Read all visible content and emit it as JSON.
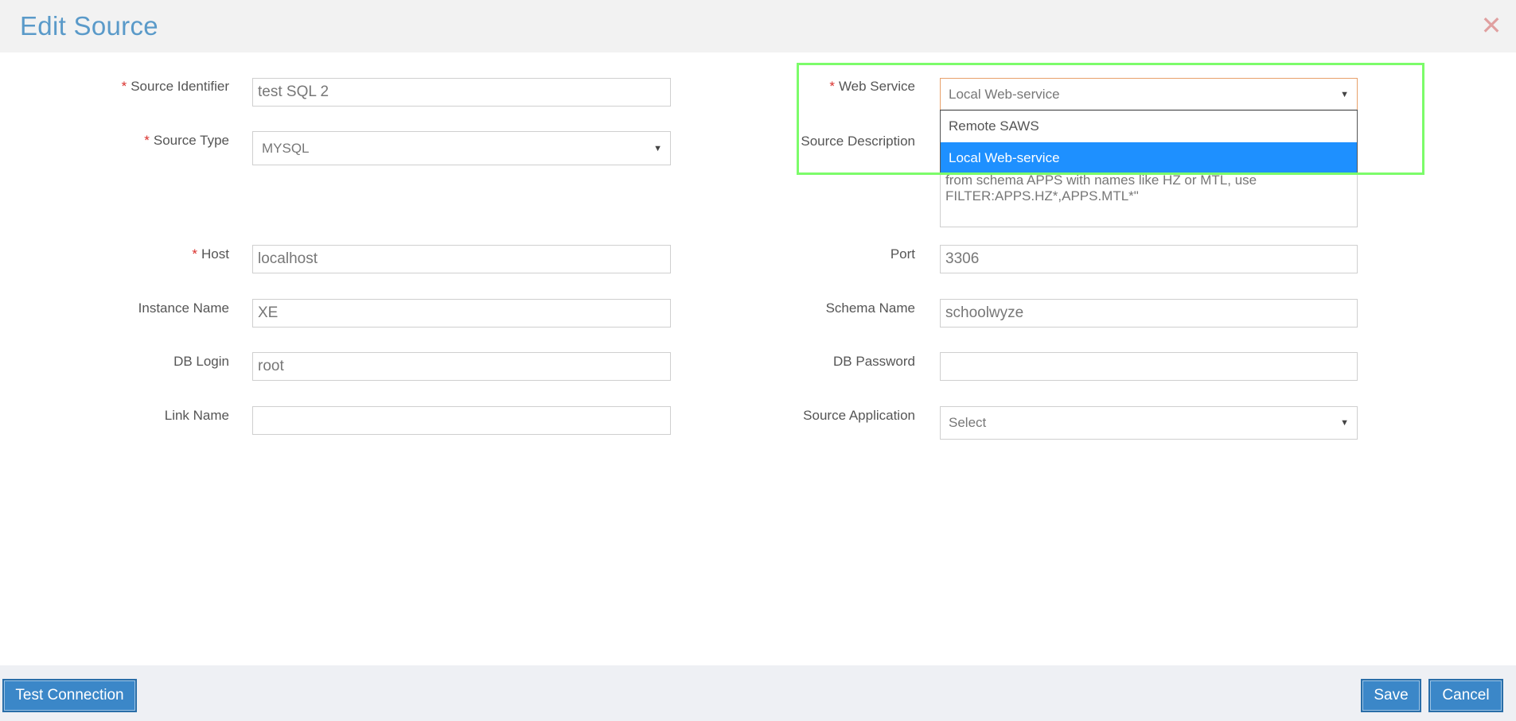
{
  "header": {
    "title": "Edit Source",
    "close_icon": "close-icon"
  },
  "fields": {
    "source_identifier": {
      "label": "Source Identifier",
      "required": "*",
      "value": "test SQL 2"
    },
    "source_type": {
      "label": "Source Type",
      "required": "*",
      "value": "MYSQL"
    },
    "host": {
      "label": "Host",
      "required": "*",
      "value": "localhost"
    },
    "instance_name": {
      "label": "Instance Name",
      "value": "XE"
    },
    "db_login": {
      "label": "DB Login",
      "value": "root"
    },
    "link_name": {
      "label": "Link Name",
      "value": ""
    },
    "web_service": {
      "label": "Web Service",
      "required": "*",
      "value": "Local Web-service",
      "options": [
        "Remote SAWS",
        "Local Web-service"
      ]
    },
    "source_description": {
      "label": "Source Description",
      "line1": "from schema APPS with names like HZ or MTL, use",
      "line2": "FILTER:APPS.HZ*,APPS.MTL*\""
    },
    "port": {
      "label": "Port",
      "value": "3306"
    },
    "schema_name": {
      "label": "Schema Name",
      "value": "schoolwyze"
    },
    "db_password": {
      "label": "DB Password",
      "value": ""
    },
    "source_application": {
      "label": "Source Application",
      "value": "Select"
    }
  },
  "footer": {
    "test_connection": "Test Connection",
    "save": "Save",
    "cancel": "Cancel"
  },
  "colors": {
    "accent": "#3b87c8",
    "title": "#5a9ac9",
    "highlight": "#7cfc6a",
    "selected_option": "#1e90ff",
    "required": "#d9302c"
  }
}
